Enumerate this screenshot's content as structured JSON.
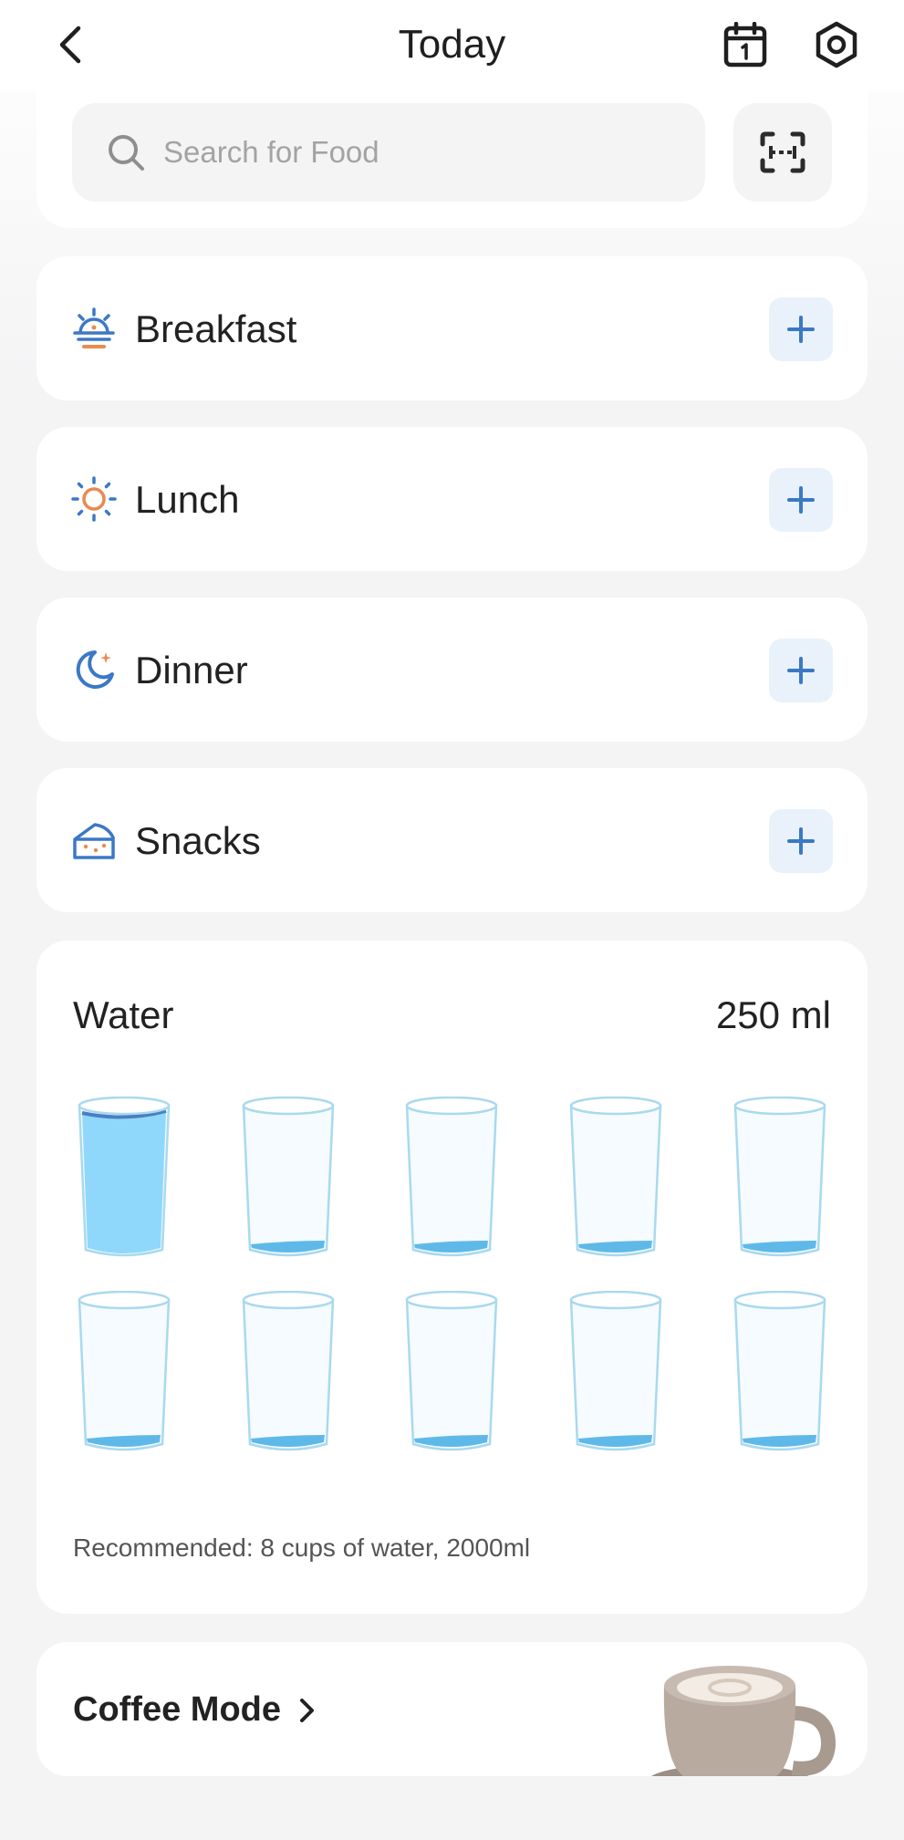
{
  "header": {
    "title": "Today"
  },
  "search": {
    "placeholder": "Search for Food"
  },
  "meals": [
    {
      "label": "Breakfast",
      "icon": "sunrise-icon"
    },
    {
      "label": "Lunch",
      "icon": "sun-icon"
    },
    {
      "label": "Dinner",
      "icon": "moon-icon"
    },
    {
      "label": "Snacks",
      "icon": "cheese-icon"
    }
  ],
  "water": {
    "title": "Water",
    "amount": "250 ml",
    "cups_total": 10,
    "cups_filled": 1,
    "note": "Recommended: 8 cups of water, 2000ml"
  },
  "coffee": {
    "label": "Coffee Mode"
  },
  "colors": {
    "accent_blue": "#3b78c6",
    "accent_orange": "#e98a4f",
    "water_fill": "#8fd8fb"
  }
}
